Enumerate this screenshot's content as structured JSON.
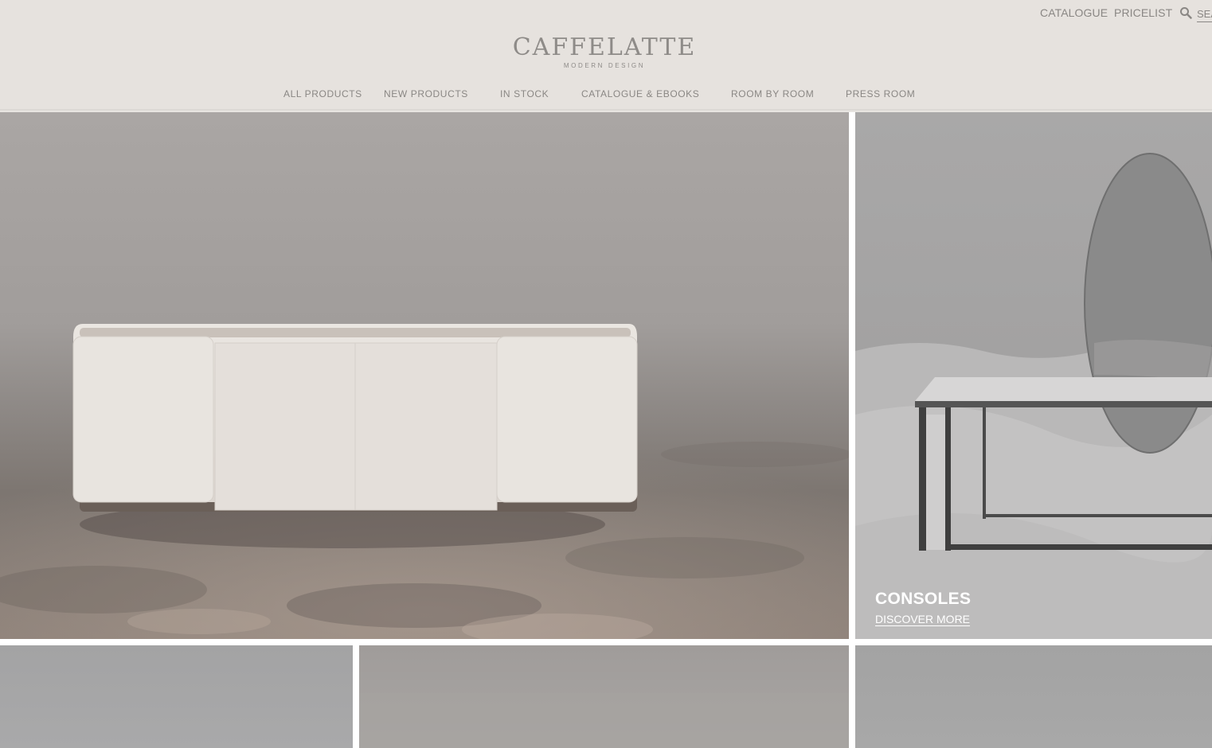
{
  "utility": {
    "catalogue_label": "CATALOGUE",
    "pricelist_label": "PRICELIST",
    "search_icon": "search-icon",
    "search_placeholder": "SEARCH"
  },
  "brand": {
    "name": "CAFFELATTE",
    "tagline": "MODERN DESIGN"
  },
  "nav": {
    "items": [
      {
        "label": "ALL PRODUCTS"
      },
      {
        "label": "NEW PRODUCTS"
      },
      {
        "label": "IN STOCK"
      },
      {
        "label": "CATALOGUE & EBOOKS"
      },
      {
        "label": "ROOM BY ROOM"
      },
      {
        "label": "PRESS ROOM"
      }
    ]
  },
  "tiles": {
    "consoles": {
      "title": "CONSOLES",
      "link": "DISCOVER MORE"
    }
  },
  "colors": {
    "header_bg": "#e6e2de",
    "header_text": "#8a8784",
    "tile_text": "#ffffff"
  }
}
